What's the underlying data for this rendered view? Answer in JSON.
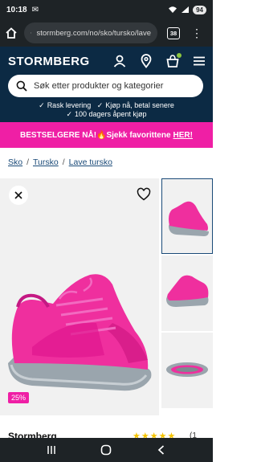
{
  "status": {
    "time": "10:18",
    "battery": "94"
  },
  "browser": {
    "url": "stormberg.com/no/sko/tursko/lave",
    "tab_count": "38"
  },
  "header": {
    "logo": "STORMBERG",
    "search_placeholder": "Søk etter produkter og kategorier",
    "usp": [
      "Rask levering",
      "Kjøp nå, betal senere",
      "100 dagers åpent kjøp"
    ]
  },
  "banner": {
    "text": "BESTSELGERE NÅ!🔥Sjekk favorittene",
    "link": "HER!"
  },
  "breadcrumb": {
    "items": [
      "Sko",
      "Tursko",
      "Lave tursko"
    ],
    "separator": "/"
  },
  "product": {
    "discount": "25%",
    "brand": "Stormberg",
    "stars": "★★★★★",
    "rating_count": "(1",
    "colors": {
      "shoe": "#ef2f9e",
      "sole": "#9aa5ad",
      "accent": "#ef1fa5",
      "header": "#0c2a44"
    }
  }
}
